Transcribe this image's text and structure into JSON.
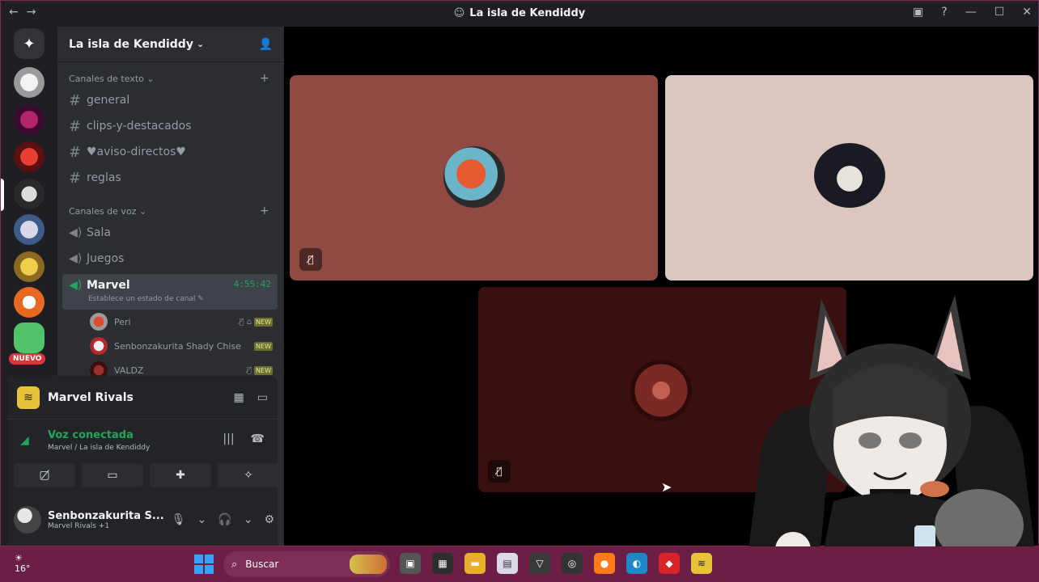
{
  "window": {
    "title": "La isla de Kendiddy"
  },
  "guild": {
    "name": "La isla de Kendiddy",
    "text_category": "Canales de texto",
    "voice_category": "Canales de voz",
    "text_channels": [
      "general",
      "clips-y-destacados",
      "♥aviso-directos♥",
      "reglas"
    ],
    "voice_channels": [
      "Sala",
      "Juegos"
    ],
    "active_voice": {
      "name": "Marvel",
      "timer": "4:55:42",
      "status_hint": "Establece un estado de canal"
    },
    "voice_users": [
      {
        "name": "Peri",
        "badge": "NEW"
      },
      {
        "name": "Senbonzakurita Shady Chise",
        "badge": "NEW"
      },
      {
        "name": "VALDZ",
        "badge": "NEW"
      }
    ],
    "nuevo_badge": "NUEVO"
  },
  "activity": {
    "game": "Marvel Rivals",
    "voice_status": "Voz conectada",
    "voice_channel": "Marvel / La isla de Kendiddy"
  },
  "user": {
    "name": "Senbonzakurita S...",
    "status": "Marvel Rivals +1"
  },
  "taskbar": {
    "weather": "16°",
    "search_placeholder": "Buscar"
  },
  "colors": {
    "tile1": "#8f4a44",
    "tile2": "#dcc7c0",
    "tile3": "#3a0f0f",
    "accent_green": "#23a55a"
  }
}
